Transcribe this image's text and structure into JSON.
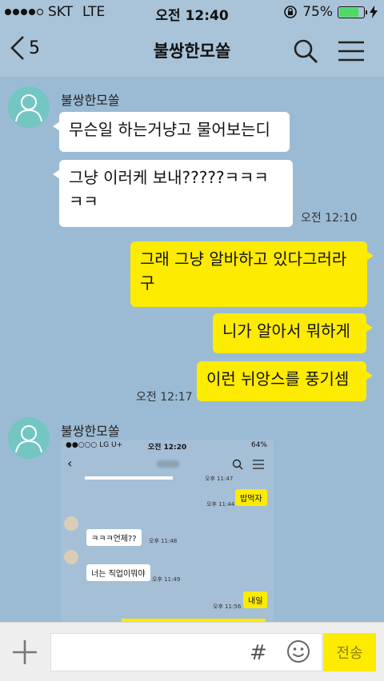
{
  "status": {
    "carrier": "SKT",
    "network": "LTE",
    "time": "오전 12:40",
    "battery": "75%"
  },
  "nav": {
    "back_count": "5",
    "title": "불쌍한모쏠"
  },
  "messages": {
    "m1": {
      "sender": "불쌍한모쏠",
      "bubble1": "무슨일 하는거냥고 물어보는디",
      "bubble2_line1": "그냥 이러케 보내?????ㅋㅋㅋ",
      "bubble2_line2": "ㅋㅋ",
      "time": "오전 12:10"
    },
    "m2": {
      "bubble1_line1": "그래 그냥 알바하고 있다그러라",
      "bubble1_line2": "구",
      "bubble2": "니가 알아서 뭐하게",
      "bubble3": "이런 뉘앙스를 풍기셈",
      "time": "오전 12:17"
    },
    "m3": {
      "sender": "불쌍한모쏠"
    }
  },
  "embedded": {
    "status_left": "LG U+",
    "status_time": "오전 12:20",
    "status_right": "64%",
    "msg1": "밥먹자",
    "msg1_time": "오후 11:44",
    "msg2": "ㅋㅋㅋ언제??",
    "msg2_time": "오후 11:48",
    "msg3": "너는 직업이뭐야",
    "msg3_time": "오후 11:49",
    "msg4": "내일",
    "msg4_time": "오후 11:56",
    "top_time": "오후 11:47"
  },
  "input": {
    "send_label": "전송",
    "hash": "#"
  },
  "colors": {
    "background": "#9bbbd4",
    "my_bubble": "#fdeb01",
    "their_bubble": "#ffffff",
    "avatar": "#74c6c3"
  }
}
